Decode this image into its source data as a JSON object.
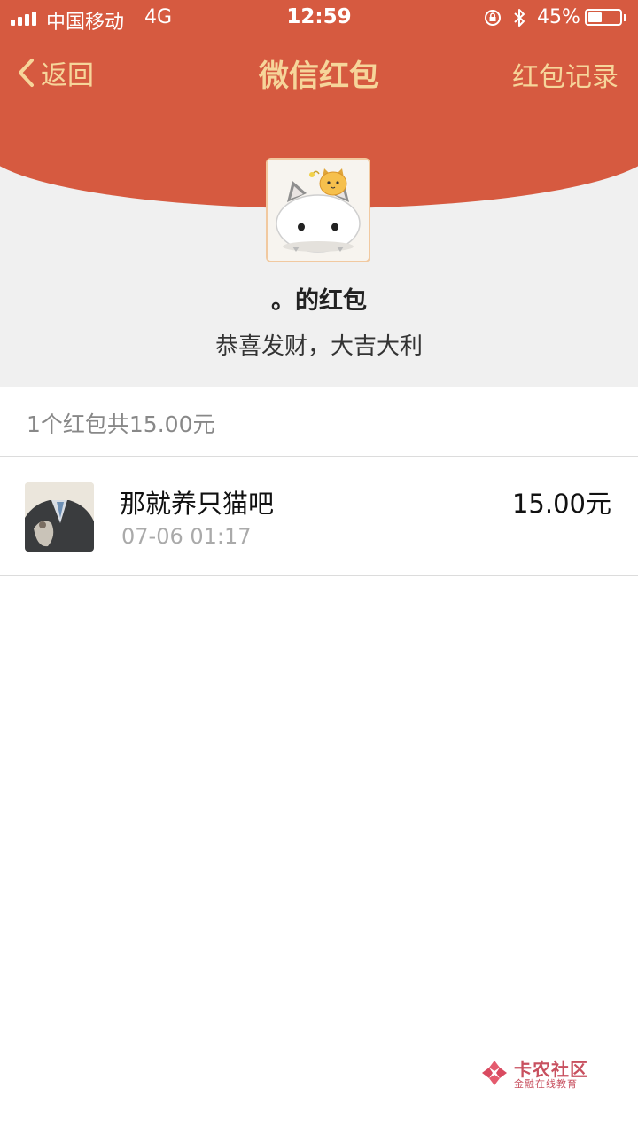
{
  "status_bar": {
    "carrier": "中国移动",
    "network": "4G",
    "time": "12:59",
    "battery_percent": "45%",
    "battery_level": 0.45,
    "icons": [
      "signal-icon",
      "rotation-lock-icon",
      "bluetooth-icon",
      "battery-icon"
    ]
  },
  "nav": {
    "back_label": "返回",
    "title": "微信红包",
    "right_label": "红包记录"
  },
  "envelope": {
    "sender_title": "。的红包",
    "wish": "恭喜发财，大吉大利"
  },
  "summary": {
    "text": "1个红包共15.00元"
  },
  "records": [
    {
      "name": "那就养只猫吧",
      "time": "07-06 01:17",
      "amount": "15.00元"
    }
  ],
  "watermark": {
    "title": "卡农社区",
    "subtitle": "金融在线教育"
  },
  "colors": {
    "header_red": "#d65a40",
    "nav_gold": "#f6d59a",
    "background_gray": "#f0f0f0"
  }
}
